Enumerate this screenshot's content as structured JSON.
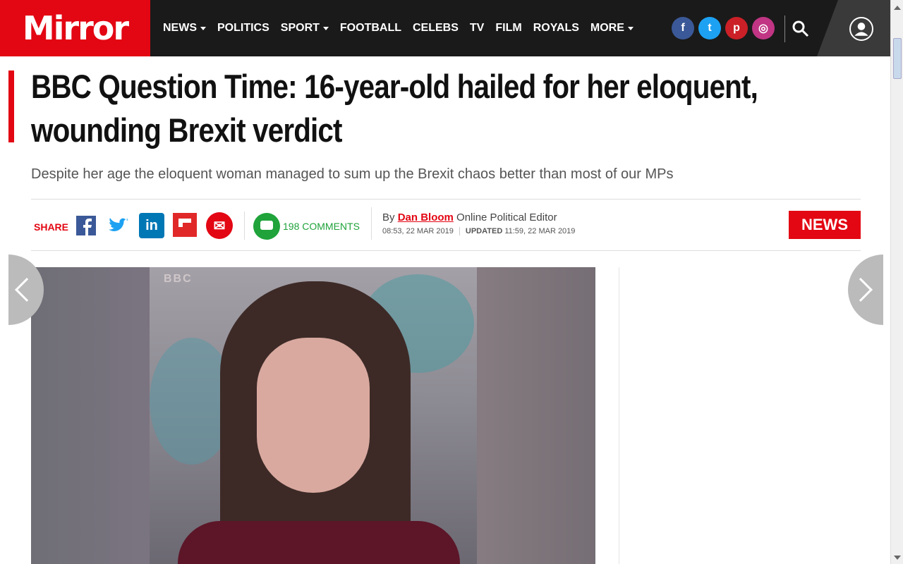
{
  "brand": {
    "logo_text": "Mirror",
    "accent": "#e30613"
  },
  "nav": {
    "items": [
      {
        "label": "NEWS",
        "dropdown": true
      },
      {
        "label": "POLITICS",
        "dropdown": false
      },
      {
        "label": "SPORT",
        "dropdown": true
      },
      {
        "label": "FOOTBALL",
        "dropdown": false
      },
      {
        "label": "CELEBS",
        "dropdown": false
      },
      {
        "label": "TV",
        "dropdown": false
      },
      {
        "label": "FILM",
        "dropdown": false
      },
      {
        "label": "ROYALS",
        "dropdown": false
      },
      {
        "label": "MORE",
        "dropdown": true
      }
    ],
    "socials": [
      {
        "name": "facebook-icon",
        "glyph": "f",
        "color": "#3b5998"
      },
      {
        "name": "twitter-icon",
        "glyph": "t",
        "color": "#1da1f2"
      },
      {
        "name": "pinterest-icon",
        "glyph": "p",
        "color": "#cb2027"
      },
      {
        "name": "instagram-icon",
        "glyph": "◎",
        "color": "#c13584"
      }
    ]
  },
  "article": {
    "headline_line1": "BBC Question Time: 16-year-old hailed for her eloquent,",
    "headline_line2": "wounding Brexit verdict",
    "subhead": "Despite her age the eloquent woman managed to sum up the Brexit chaos better than most of our MPs",
    "share_label": "SHARE",
    "comments": "198 COMMENTS",
    "byline_prefix": "By",
    "author": "Dan Bloom",
    "author_role": "Online Political Editor",
    "published": "08:53, 22 MAR 2019",
    "updated_label": "UPDATED",
    "updated": "11:59, 22 MAR 2019",
    "section_badge": "NEWS",
    "image_watermark": "BBC"
  },
  "share_icons": [
    {
      "name": "facebook-share-icon",
      "glyph": "f",
      "color": "#3b5998"
    },
    {
      "name": "twitter-share-icon",
      "glyph": "🐦",
      "color": "#1da1f2"
    },
    {
      "name": "linkedin-share-icon",
      "glyph": "in",
      "color": "#0077b5"
    },
    {
      "name": "flipboard-share-icon",
      "glyph": "F",
      "color": "#e12828"
    },
    {
      "name": "email-share-icon",
      "glyph": "✉",
      "color": "#e30613"
    }
  ]
}
